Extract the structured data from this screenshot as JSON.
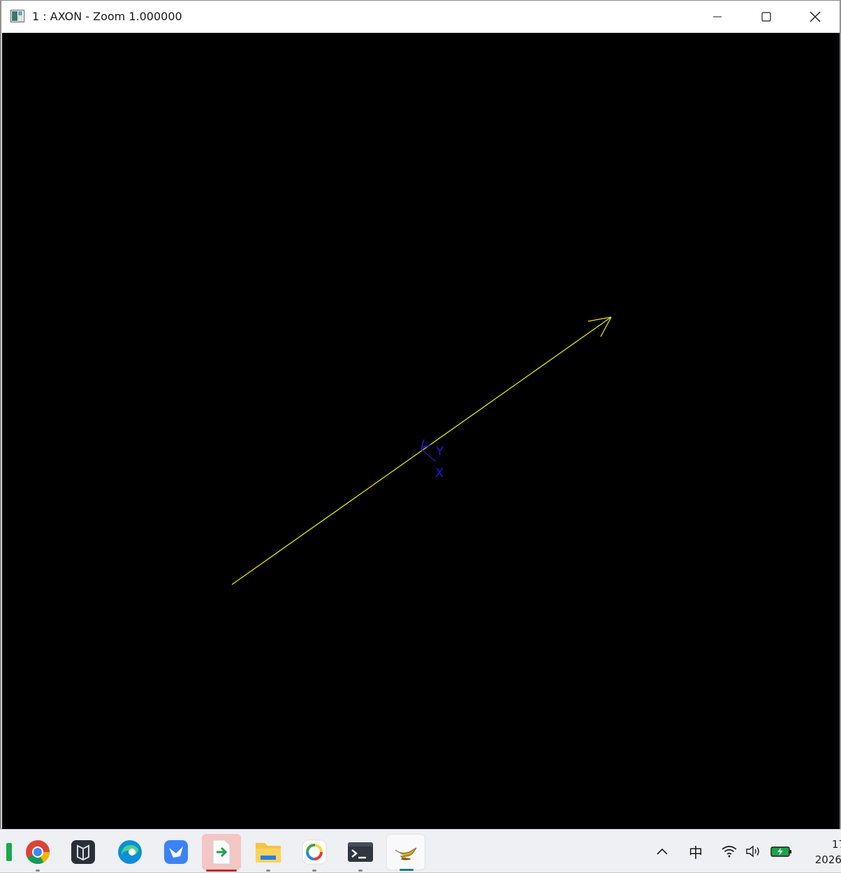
{
  "window": {
    "title": "1 : AXON - Zoom 1.000000",
    "controls": {
      "minimize_label": "Minimize",
      "maximize_label": "Maximize",
      "close_label": "Close"
    }
  },
  "viewport": {
    "background": "#000000",
    "vector_color": "#ffff00",
    "axis_color": "#0000ff",
    "axis_labels": {
      "y": "Y",
      "x": "X"
    }
  },
  "taskbar": {
    "apps": [
      {
        "name": "chrome-icon"
      },
      {
        "name": "dark-app-icon"
      },
      {
        "name": "edge-icon"
      },
      {
        "name": "feishu-icon"
      },
      {
        "name": "transfer-icon",
        "state": "active"
      },
      {
        "name": "file-explorer-icon"
      },
      {
        "name": "colorful-app-icon"
      },
      {
        "name": "terminal-icon"
      },
      {
        "name": "lamp-icon",
        "state": "focused"
      }
    ],
    "tray": {
      "ime": "中",
      "icons": [
        "chevron-up-icon",
        "wifi-icon",
        "volume-icon",
        "battery-icon"
      ]
    },
    "clock": {
      "time": "17",
      "date": "2026/"
    }
  }
}
